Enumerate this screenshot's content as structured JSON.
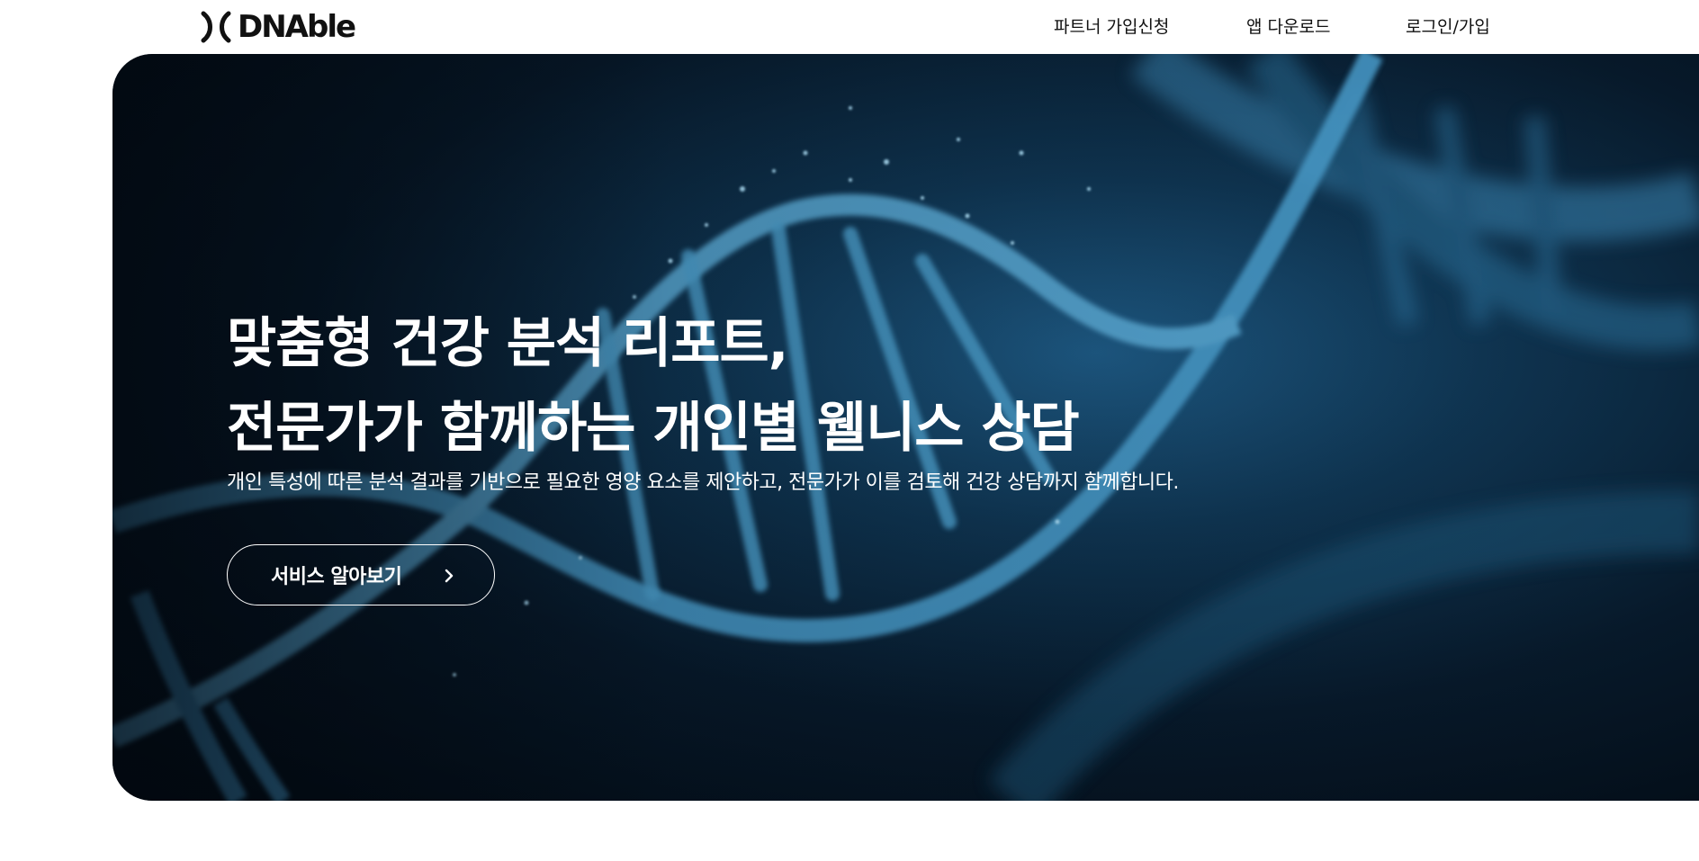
{
  "header": {
    "logo_text": "DNAble",
    "nav": [
      {
        "label": "파트너 가입신청"
      },
      {
        "label": "앱 다운로드"
      },
      {
        "label": "로그인/가입"
      }
    ]
  },
  "hero": {
    "title_line1": "맞춤형 건강 분석 리포트,",
    "title_line2": "전문가가 함께하는 개인별 웰니스 상담",
    "subtitle": "개인 특성에 따른 분석 결과를 기반으로 필요한 영양 요소를 제안하고, 전문가가 이를 검토해 건강 상담까지 함께합니다.",
    "cta_label": "서비스 알아보기",
    "cta_icon": "chevron-right-icon",
    "background": "dna-helix-image"
  },
  "colors": {
    "hero_dark": "#02080f",
    "hero_blue": "#1e5b86",
    "text_on_hero": "#ffffff",
    "nav_text": "#111111"
  }
}
